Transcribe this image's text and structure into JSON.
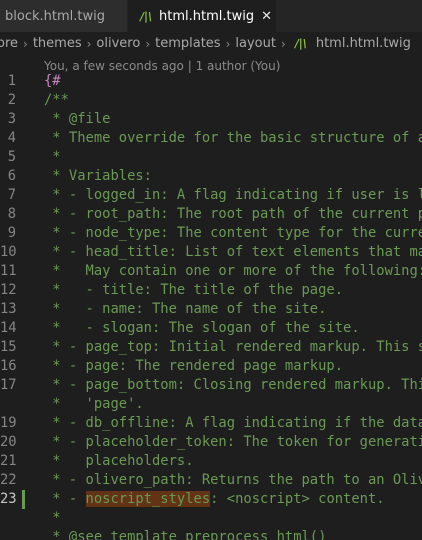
{
  "tabs": [
    {
      "label": "block.html.twig",
      "active": false
    },
    {
      "label": "html.html.twig",
      "active": true,
      "icon": "twig-file-icon",
      "close_glyph": "✕"
    }
  ],
  "breadcrumb": {
    "items": [
      "ore",
      "themes",
      "olivero",
      "templates",
      "layout"
    ],
    "file": "html.html.twig",
    "file_icon_glyph": "/|\\"
  },
  "codelens": "You, a few seconds ago | 1 author (You)",
  "lines": [
    {
      "n": "1",
      "text": "{#"
    },
    {
      "n": "2",
      "text": "/**"
    },
    {
      "n": "3",
      "text": " * @file"
    },
    {
      "n": "4",
      "text": " * Theme override for the basic structure of a single Drupal page."
    },
    {
      "n": "5",
      "text": " *"
    },
    {
      "n": "6",
      "text": " * Variables:"
    },
    {
      "n": "7",
      "text": " * - logged_in: A flag indicating if user is logged in."
    },
    {
      "n": "8",
      "text": " * - root_path: The root path of the current page (e.g., node, admin, user)."
    },
    {
      "n": "9",
      "text": " * - node_type: The content type for the current node, if the page is a node."
    },
    {
      "n": "10",
      "text": " * - head_title: List of text elements that make up the head_title variable."
    },
    {
      "n": "11",
      "text": " *   May contain one or more of the following:"
    },
    {
      "n": "12",
      "text": " *   - title: The title of the page."
    },
    {
      "n": "13",
      "text": " *   - name: The name of the site."
    },
    {
      "n": "14",
      "text": " *   - slogan: The slogan of the site."
    },
    {
      "n": "15",
      "text": " * - page_top: Initial rendered markup. This should be printed before 'page'."
    },
    {
      "n": "16",
      "text": " * - page: The rendered page markup."
    },
    {
      "n": "17",
      "text": " * - page_bottom: Closing rendered markup. This variable should be printed after"
    },
    {
      "n": "",
      "text": " *   'page'."
    },
    {
      "n": "19",
      "text": " * - db_offline: A flag indicating if the database is offline."
    },
    {
      "n": "20",
      "text": " * - placeholder_token: The token for generating head, css, js and js-bottom"
    },
    {
      "n": "21",
      "text": " *   placeholders."
    },
    {
      "n": "22",
      "text": " * - olivero_path: Returns the path to an Olivero theme."
    },
    {
      "n": "23",
      "text_before": " * - ",
      "highlight": "noscript_styles",
      "text_after": ": <noscript> content."
    },
    {
      "n": "",
      "text": " *"
    },
    {
      "n": "",
      "text": " * @see template_preprocess_html()"
    }
  ],
  "colors": {
    "comment": "#6a9955",
    "brace": "#c586c0",
    "highlight_bg": "#623315",
    "twig_icon": "#8dc149"
  }
}
